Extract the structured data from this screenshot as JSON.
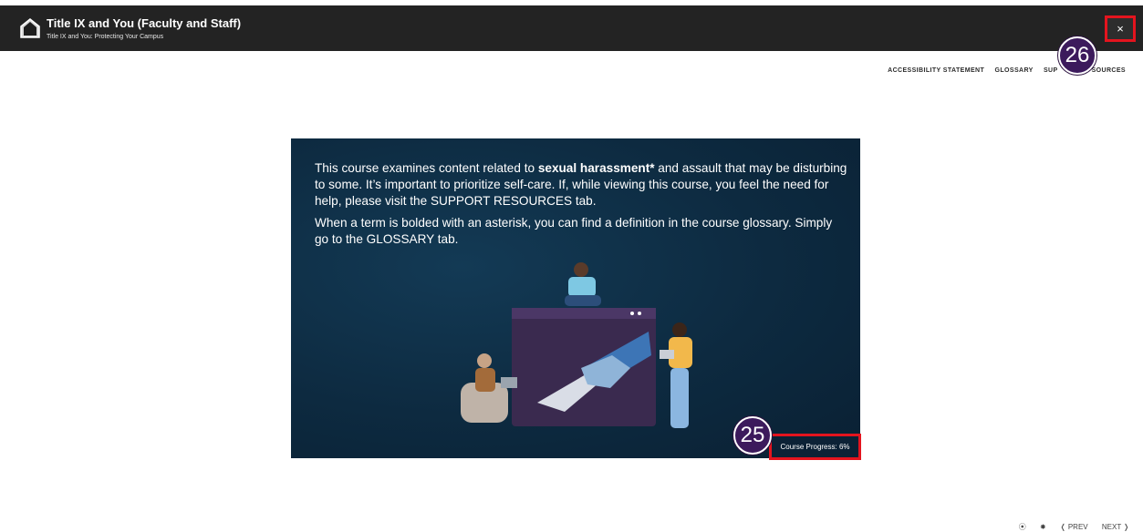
{
  "header": {
    "title": "Title IX and You (Faculty and Staff)",
    "subtitle": "Title IX and You: Protecting Your Campus",
    "close_label": "×"
  },
  "nav": {
    "accessibility": "ACCESSIBILITY STATEMENT",
    "glossary": "GLOSSARY",
    "support_left": "SUP",
    "support_right": "SOURCES"
  },
  "slide": {
    "para1_a": "This course examines content related to ",
    "para1_bold": "sexual harassment*",
    "para1_b": " and assault that may be disturbing to some. It’s important to prioritize self-care. If, while viewing this course, you feel the need for help, please visit the SUPPORT RESOURCES tab.",
    "para2": "When a term is bolded with an asterisk, you can find a definition in the course glossary. Simply go to the GLOSSARY tab.",
    "progress": "Course Progress: 6%"
  },
  "markers": {
    "close": "26",
    "progress": "25"
  },
  "controls": {
    "play": "⦿",
    "settings": "✸",
    "prev": "❬ PREV",
    "next": "NEXT ❭"
  },
  "colors": {
    "header_bg": "#232323",
    "highlight": "#e4141e",
    "marker": "#3c1a5c"
  }
}
